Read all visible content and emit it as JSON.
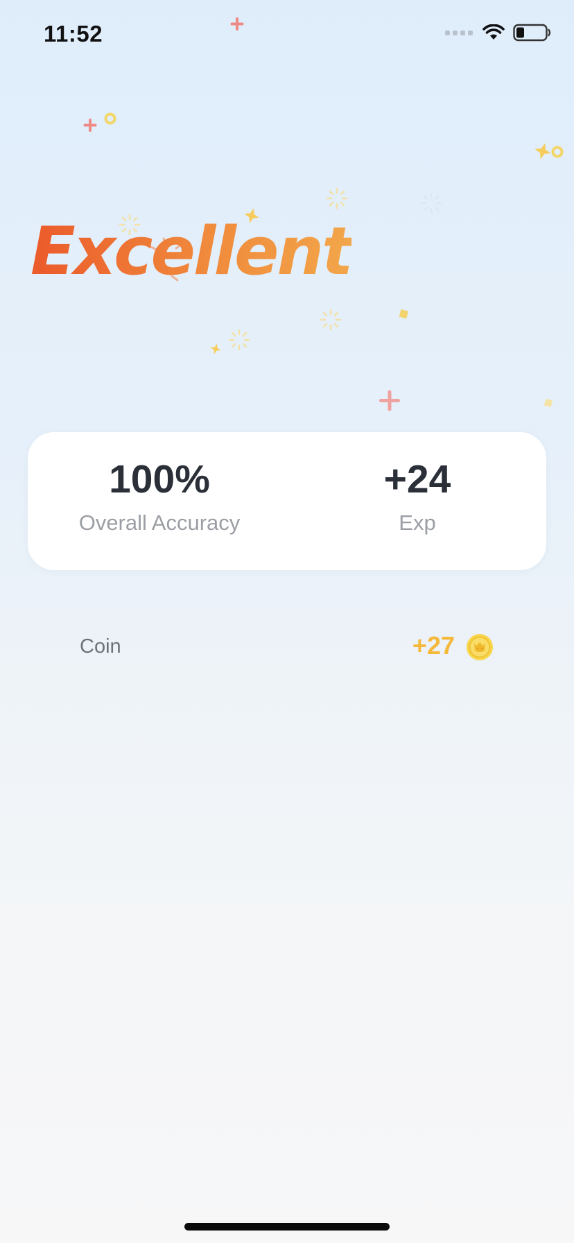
{
  "status_bar": {
    "time": "11:52",
    "icons": [
      "cellular-signal-icon",
      "wifi-icon",
      "battery-icon"
    ]
  },
  "result": {
    "headline": "Excellent"
  },
  "stats": {
    "accuracy_value": "100%",
    "accuracy_label": "Overall Accuracy",
    "exp_value": "+24",
    "exp_label": "Exp"
  },
  "coin": {
    "label": "Coin",
    "amount": "+27",
    "icon": "coin-icon"
  },
  "colors": {
    "headline_gradient_start": "#eb5a2b",
    "headline_gradient_end": "#f2a64a",
    "coin_accent": "#f4b93a",
    "stat_value": "#2a2f38",
    "stat_label": "#9b9ea4"
  }
}
